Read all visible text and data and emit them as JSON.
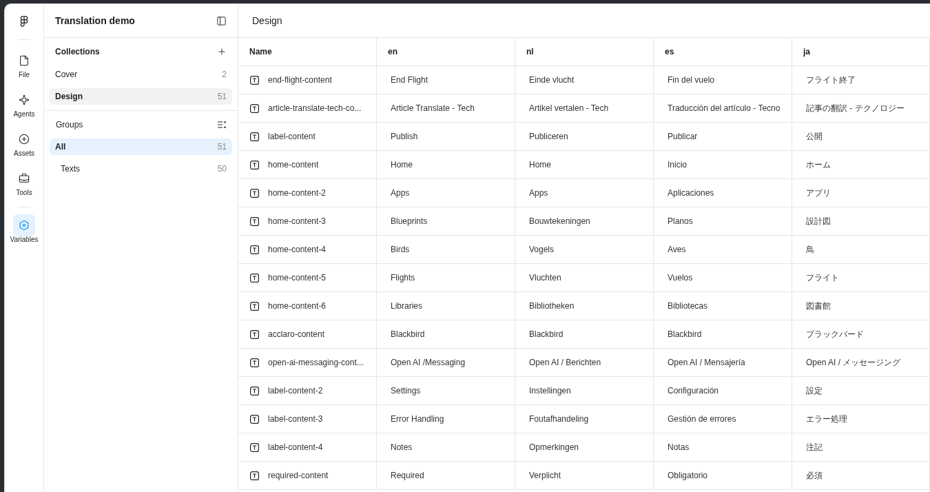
{
  "rail": [
    {
      "kind": "file",
      "label": "File",
      "selected": false
    },
    {
      "kind": "agents",
      "label": "Agents",
      "selected": false
    },
    {
      "kind": "assets",
      "label": "Assets",
      "selected": false
    },
    {
      "kind": "tools",
      "label": "Tools",
      "selected": false
    },
    {
      "kind": "variables",
      "label": "Variables",
      "selected": true
    }
  ],
  "sidebar": {
    "title": "Translation demo",
    "collections": {
      "heading": "Collections",
      "items": [
        {
          "label": "Cover",
          "count": "2",
          "selected": false
        },
        {
          "label": "Design",
          "count": "51",
          "selected": true
        }
      ]
    },
    "groups": {
      "heading": "Groups",
      "items": [
        {
          "label": "All",
          "count": "51",
          "selected": true,
          "children": [
            {
              "label": "Texts",
              "count": "50",
              "selected": false
            }
          ]
        }
      ]
    }
  },
  "main": {
    "title": "Design",
    "table": {
      "columns": [
        "Name",
        "en",
        "nl",
        "es",
        "ja"
      ],
      "rows": [
        [
          "end-flight-content",
          "End Flight",
          "Einde vlucht",
          "Fin del vuelo",
          "フライト終了"
        ],
        [
          "article-translate-tech-co...",
          "Article Translate - Tech",
          "Artikel vertalen - Tech",
          "Traducción del artículo - Tecno",
          "記事の翻訳 - テクノロジー"
        ],
        [
          "label-content",
          "Publish",
          "Publiceren",
          "Publicar",
          "公開"
        ],
        [
          "home-content",
          "Home",
          "Home",
          "Inicio",
          "ホーム"
        ],
        [
          "home-content-2",
          "Apps",
          "Apps",
          "Aplicaciones",
          "アプリ"
        ],
        [
          "home-content-3",
          "Blueprints",
          "Bouwtekeningen",
          "Planos",
          "設計図"
        ],
        [
          "home-content-4",
          "Birds",
          "Vogels",
          "Aves",
          "鳥"
        ],
        [
          "home-content-5",
          "Flights",
          "Vluchten",
          "Vuelos",
          "フライト"
        ],
        [
          "home-content-6",
          "Libraries",
          "Bibliotheken",
          "Bibliotecas",
          "図書館"
        ],
        [
          "acclaro-content",
          "Blackbird",
          "Blackbird",
          "Blackbird",
          "ブラックバード"
        ],
        [
          "open-ai-messaging-cont...",
          "Open AI /Messaging",
          "Open AI / Berichten",
          "Open AI / Mensajería",
          "Open AI / メッセージング"
        ],
        [
          "label-content-2",
          "Settings",
          "Instellingen",
          "Configuración",
          "設定"
        ],
        [
          "label-content-3",
          "Error Handling",
          "Foutafhandeling",
          "Gestión de errores",
          "エラー処理"
        ],
        [
          "label-content-4",
          "Notes",
          "Opmerkingen",
          "Notas",
          "注記"
        ],
        [
          "required-content",
          "Required",
          "Verplicht",
          "Obligatorio",
          "必須"
        ]
      ]
    }
  }
}
